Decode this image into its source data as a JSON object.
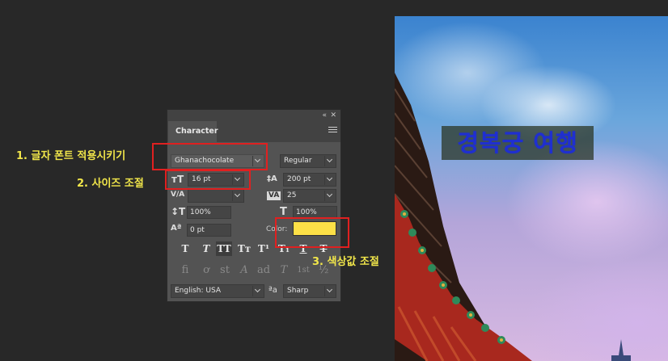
{
  "canvas": {
    "overlay_title": "경복궁 여행"
  },
  "annotations": {
    "step1": "1. 글자 폰트 적용시키기",
    "step2": "2. 사이즈 조절",
    "step3": "3. 색상값 조절",
    "color": "#f1e64a",
    "box_color": "#e02020"
  },
  "panel": {
    "collapse_icon": "«",
    "close_icon": "✕",
    "tab_label": "Character",
    "menu_icon": "hamburger-menu-icon",
    "font_family": "Ghanachocolate",
    "font_style": "Regular",
    "font_size_icon": "ᴛT",
    "font_size": "16 pt",
    "leading_icon": "‡A",
    "leading": "200 pt",
    "kerning_icon": "V/A",
    "kerning": "",
    "tracking_icon": "VA",
    "tracking": "25",
    "vertical_scale_icon": "↕T",
    "vertical_scale": "100%",
    "horizontal_scale_icon": "T",
    "horizontal_scale": "100%",
    "baseline_icon": "Aª",
    "baseline_shift": "0 pt",
    "color_label": "Color:",
    "color_value": "#fde047",
    "style_buttons": [
      "T",
      "T",
      "TT",
      "Tт",
      "T¹",
      "T₁",
      "T",
      "T"
    ],
    "opentype_buttons": [
      "fi",
      "ơ",
      "st",
      "A",
      "ad",
      "T",
      "1st",
      "½"
    ],
    "language": "English: USA",
    "aa_icon": "ªa",
    "antialias": "Sharp"
  }
}
